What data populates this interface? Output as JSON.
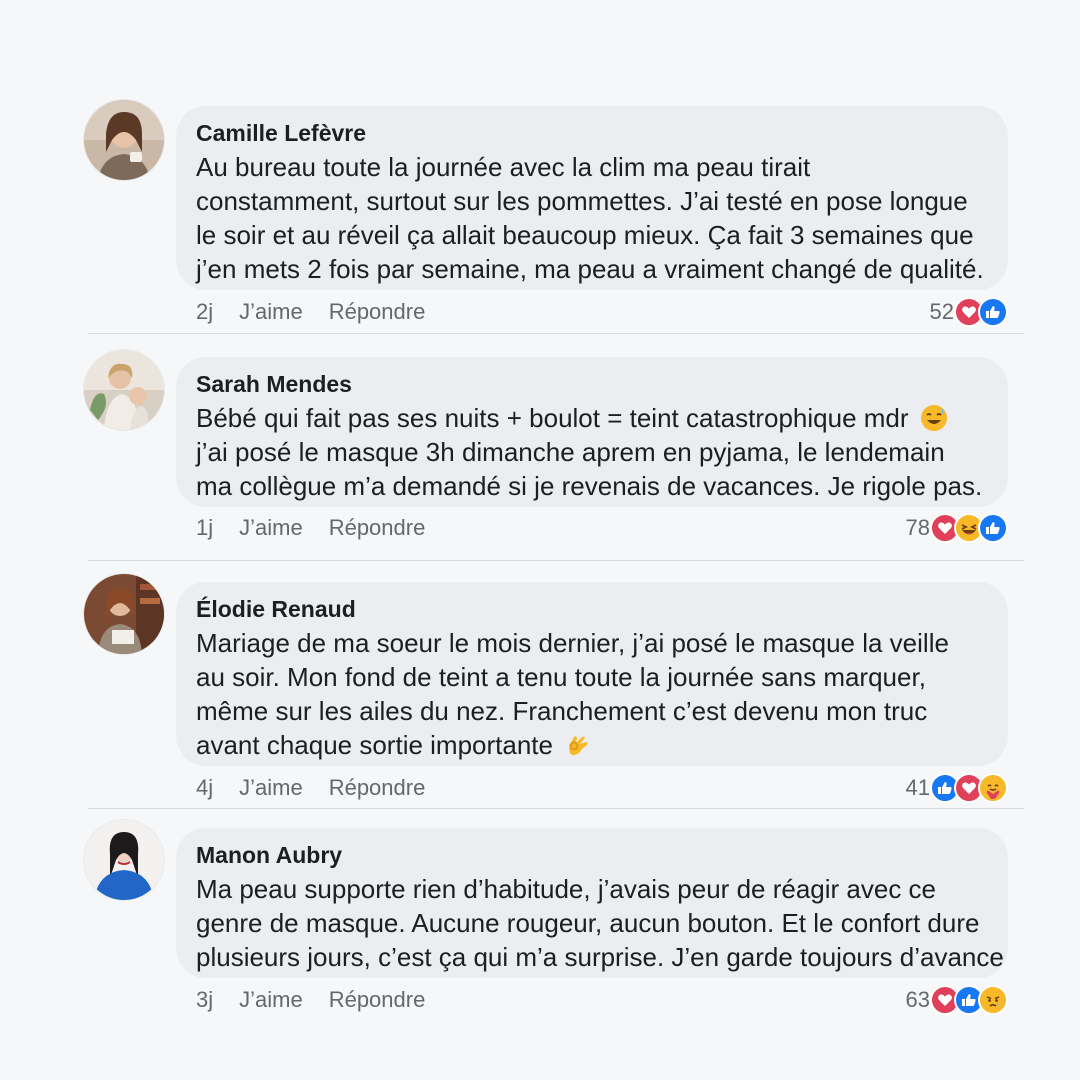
{
  "comments": [
    {
      "author": "Camille Lefèvre",
      "lines": [
        "Au bureau toute la journée avec la clim ma peau tirait",
        "constamment, surtout sur les pommettes. J’ai testé en pose longue",
        "le soir et au réveil ça allait beaucoup mieux. Ça fait 3 semaines que",
        "j’en mets 2 fois par semaine, ma peau a vraiment changé de qualité."
      ],
      "time": "2j",
      "like_label": "J’aime",
      "reply_label": "Répondre",
      "reaction_count": "52",
      "reactions": [
        "love-icon",
        "like-icon"
      ]
    },
    {
      "author": "Sarah Mendes",
      "lines": [
        "Bébé qui fait pas ses nuits + boulot = teint catastrophique mdr",
        "j’ai posé le masque 3h dimanche aprem en pyjama, le lendemain",
        "ma collègue m’a demandé si je revenais de vacances. Je rigole pas."
      ],
      "inline_emoji": "sweat-smile-emoji",
      "time": "1j",
      "like_label": "J’aime",
      "reply_label": "Répondre",
      "reaction_count": "78",
      "reactions": [
        "love-icon",
        "haha-icon",
        "like-icon"
      ]
    },
    {
      "author": "Élodie Renaud",
      "lines": [
        "Mariage de ma soeur le mois dernier, j’ai posé le masque la veille",
        "au soir. Mon fond de teint a tenu toute la journée sans marquer,",
        "même sur les ailes du nez. Franchement c’est devenu mon truc",
        "avant chaque sortie importante"
      ],
      "inline_emoji": "ok-hand-emoji",
      "time": "4j",
      "like_label": "J’aime",
      "reply_label": "Répondre",
      "reaction_count": "41",
      "reactions": [
        "like-icon",
        "love-icon",
        "care-icon"
      ]
    },
    {
      "author": "Manon Aubry",
      "lines": [
        "Ma peau supporte rien d’habitude, j’avais peur de réagir avec ce",
        "genre de masque. Aucune rougeur, aucun bouton. Et le confort dure",
        "plusieurs jours, c’est ça qui m’a surprise. J’en garde toujours d’avance"
      ],
      "time": "3j",
      "like_label": "J’aime",
      "reply_label": "Répondre",
      "reaction_count": "63",
      "reactions": [
        "love-icon",
        "like-icon",
        "sad-icon"
      ]
    }
  ],
  "colors": {
    "like": "#1877f2",
    "love": "#e0405a",
    "reaction_yellow": "#f7b928",
    "bubble": "#ebedf0",
    "secondary_text": "#65676b"
  }
}
